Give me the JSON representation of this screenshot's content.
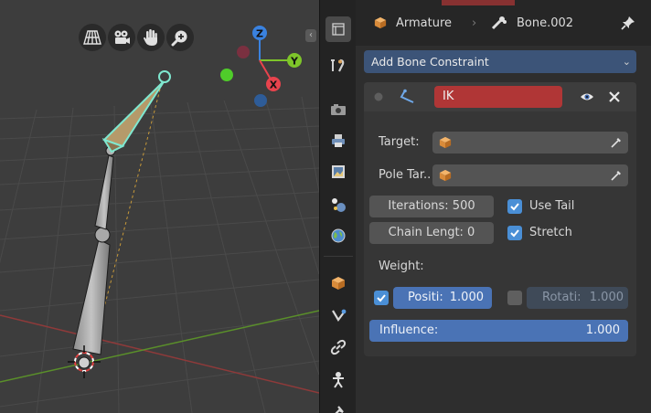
{
  "viewport": {
    "axis_labels": {
      "z": "Z",
      "y": "Y",
      "x": "X"
    },
    "nav_icons": [
      "perspective-grid-icon",
      "camera-icon",
      "hand-pan-icon",
      "zoom-icon"
    ]
  },
  "properties": {
    "header": {
      "object_name": "Armature",
      "bone_name": "Bone.002",
      "separator": "›"
    },
    "add_constraint": {
      "label": "Add Bone Constraint",
      "icon": "chevron-down-icon"
    },
    "constraint": {
      "name": "IK",
      "target": {
        "label": "Target:",
        "value": ""
      },
      "pole_target": {
        "label": "Pole Tar..",
        "value": ""
      },
      "iterations": "Iterations: 500",
      "chain_length": "Chain Lengt: 0",
      "use_tail": {
        "label": "Use Tail",
        "checked": true
      },
      "stretch": {
        "label": "Stretch",
        "checked": true
      },
      "weight_label": "Weight:",
      "position": {
        "label": "Positi:",
        "value": "1.000",
        "checked": true
      },
      "rotation": {
        "label": "Rotati:",
        "value": "1.000",
        "checked": false
      },
      "influence": {
        "label": "Influence:",
        "value": "1.000"
      }
    }
  },
  "colors": {
    "accent_blue": "#4a73b5",
    "constraint_name_bg": "#b03636",
    "axis_x": "#e8434d",
    "axis_y": "#7ec52a",
    "axis_z": "#3a82e0",
    "selected_bone": "#7fe8d0"
  }
}
